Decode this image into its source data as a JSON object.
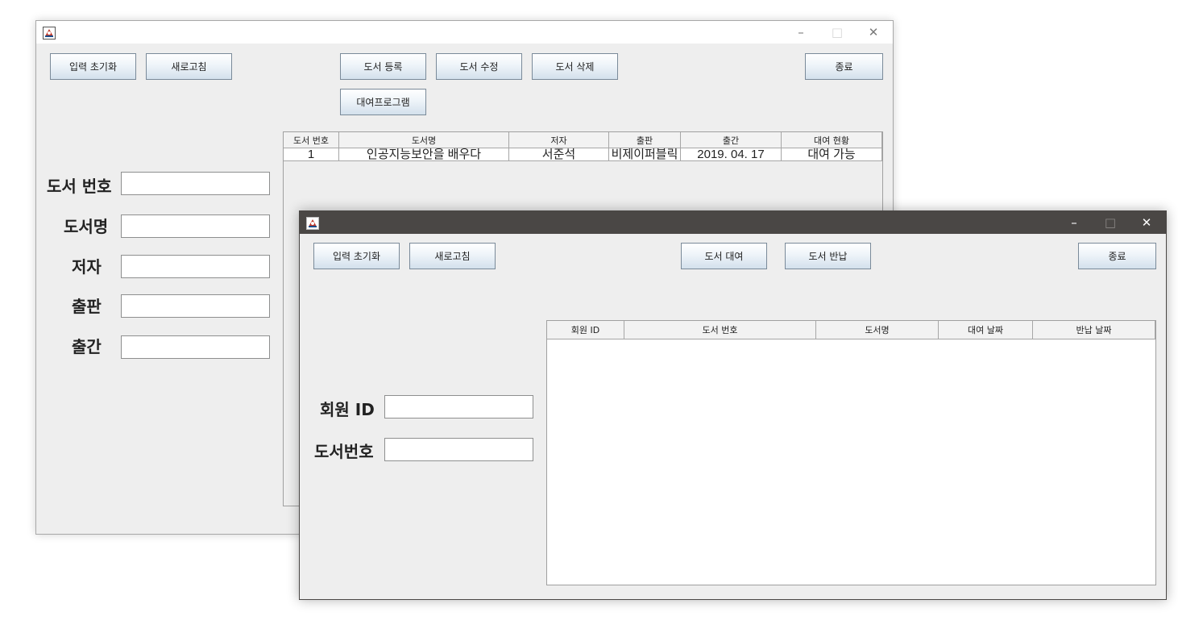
{
  "book_window": {
    "buttons": {
      "reset": "입력 초기화",
      "refresh": "새로고침",
      "register": "도서 등록",
      "edit": "도서 수정",
      "delete": "도서 삭제",
      "exit": "종료",
      "rental_program": "대여프로그램"
    },
    "labels": {
      "book_number": "도서 번호",
      "book_title": "도서명",
      "author": "저자",
      "publisher": "출판",
      "published": "출간"
    },
    "table": {
      "columns": [
        "도서 번호",
        "도서명",
        "저자",
        "출판",
        "출간",
        "대여 현황"
      ],
      "rows": [
        [
          "1",
          "인공지능보안을 배우다",
          "서준석",
          "비제이퍼블릭",
          "2019. 04. 17",
          "대여 가능"
        ]
      ]
    }
  },
  "rental_window": {
    "buttons": {
      "reset": "입력 초기화",
      "refresh": "새로고침",
      "rent": "도서 대여",
      "return": "도서 반납",
      "exit": "종료"
    },
    "labels": {
      "member_id": "회원 ID",
      "book_number": "도서번호"
    },
    "table": {
      "columns": [
        "회원 ID",
        "도서 번호",
        "도서명",
        "대여 날짜",
        "반납 날짜"
      ],
      "rows": []
    }
  },
  "window_controls": {
    "minimize": "–",
    "maximize": "□",
    "close": "✕"
  }
}
